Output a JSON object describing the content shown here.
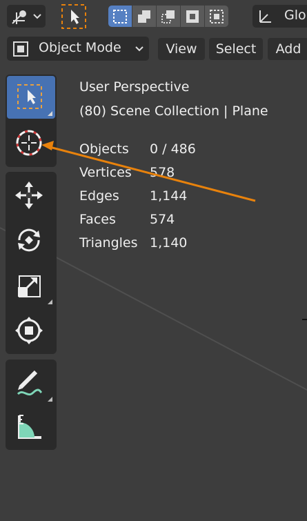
{
  "header": {
    "mode_label": "Object Mode",
    "menus": [
      {
        "label": "View"
      },
      {
        "label": "Select"
      },
      {
        "label": "Add"
      }
    ],
    "transform_orientation": "Glo"
  },
  "overlay": {
    "view_name": "User Perspective",
    "collection": "(80) Scene Collection | Plane",
    "stats": [
      {
        "label": "Objects",
        "value": "0 / 486"
      },
      {
        "label": "Vertices",
        "value": "578"
      },
      {
        "label": "Edges",
        "value": "1,144"
      },
      {
        "label": "Faces",
        "value": "574"
      },
      {
        "label": "Triangles",
        "value": "1,140"
      }
    ]
  },
  "colors": {
    "viewport_bg": "#3d3d3d",
    "active_tool": "#4772b3",
    "accent_orange": "#e8820c",
    "select_blue": "#5680c2"
  },
  "toolbar": {
    "tools": [
      {
        "icon": "select-box-icon",
        "active": true
      },
      {
        "icon": "cursor-icon"
      },
      {
        "icon": "move-icon"
      },
      {
        "icon": "rotate-icon"
      },
      {
        "icon": "scale-icon"
      },
      {
        "icon": "transform-icon"
      },
      {
        "icon": "annotate-icon"
      },
      {
        "icon": "measure-icon"
      }
    ]
  }
}
